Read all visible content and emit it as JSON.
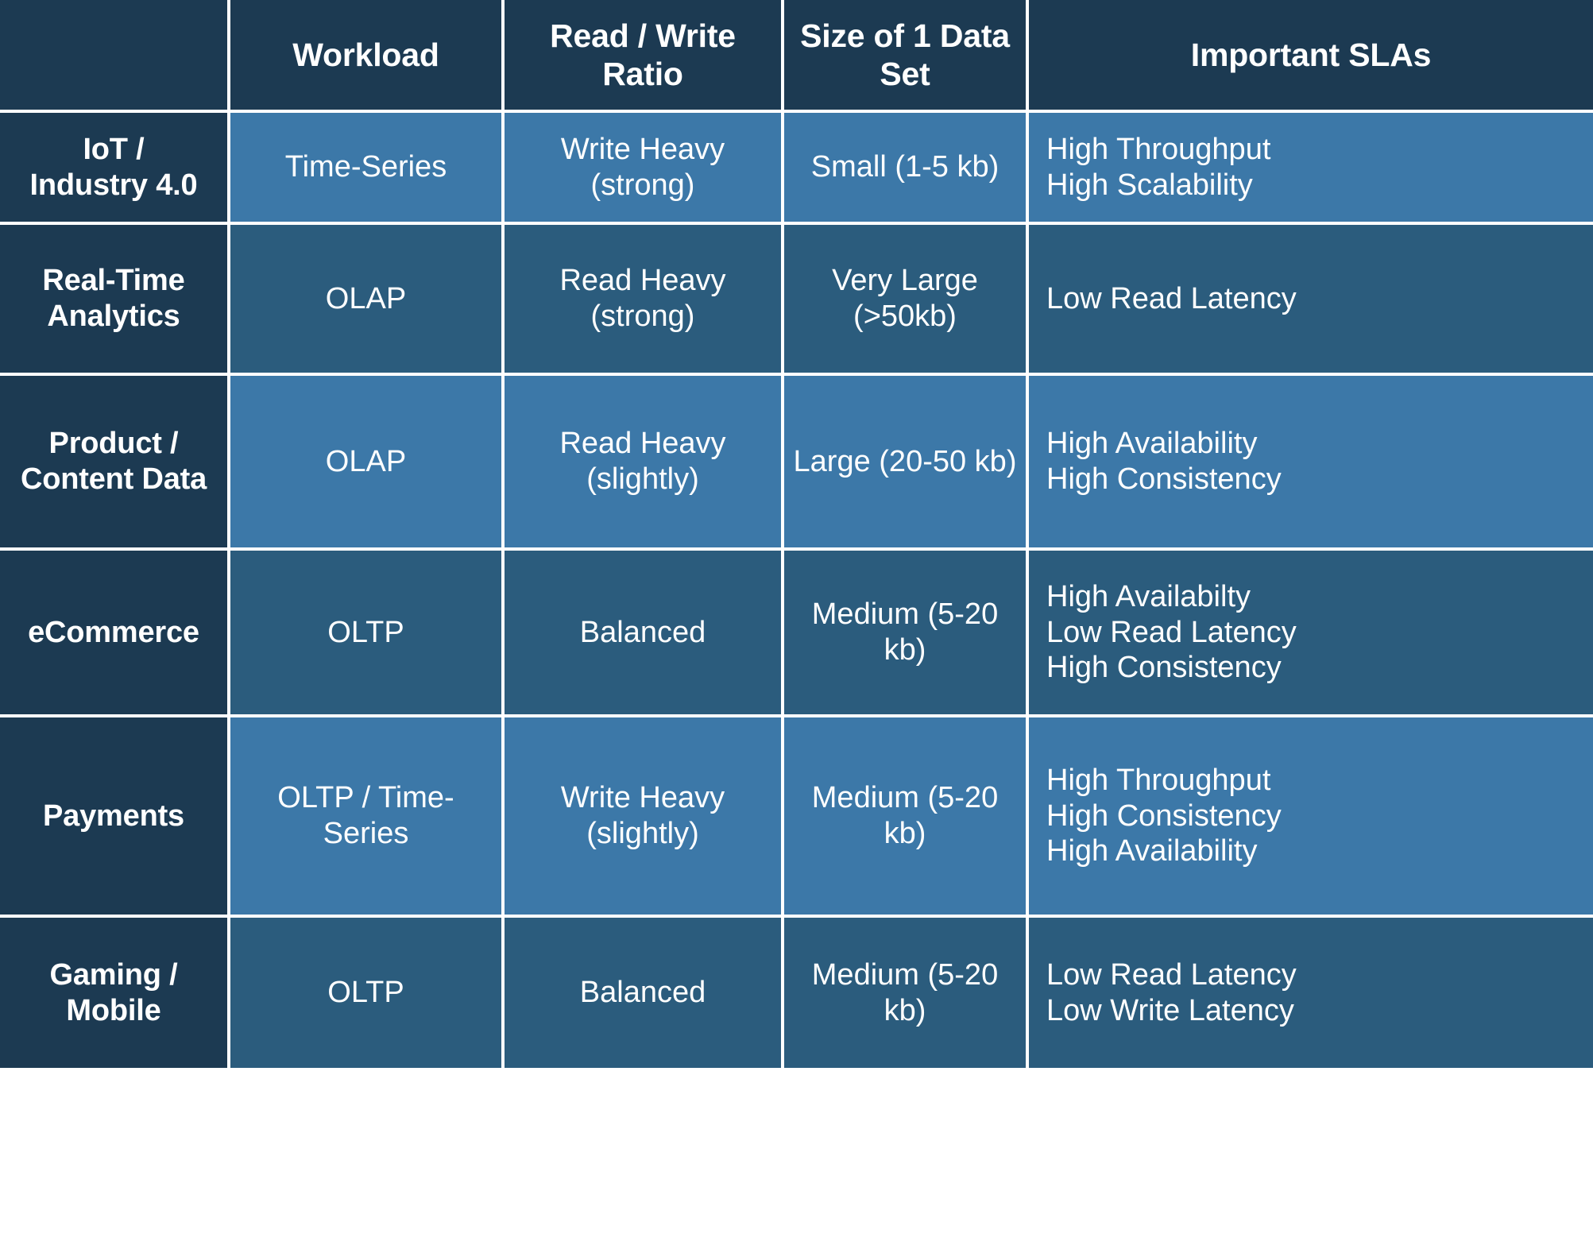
{
  "table": {
    "corner_label": "",
    "columns": [
      "Workload",
      "Read / Write Ratio",
      "Size of 1 Data Set",
      "Important SLAs"
    ],
    "rows": [
      {
        "label": "IoT /\nIndustry 4.0",
        "workload": "Time-Series",
        "read_write_ratio": "Write Heavy (strong)",
        "data_set_size": "Small (1-5 kb)",
        "slas": "High Throughput\nHigh Scalability"
      },
      {
        "label": "Real-Time\nAnalytics",
        "workload": "OLAP",
        "read_write_ratio": "Read Heavy (strong)",
        "data_set_size": "Very Large (>50kb)",
        "slas": "Low Read Latency"
      },
      {
        "label": "Product /\nContent Data",
        "workload": "OLAP",
        "read_write_ratio": "Read Heavy (slightly)",
        "data_set_size": "Large (20-50 kb)",
        "slas": "High Availability\nHigh Consistency"
      },
      {
        "label": "eCommerce",
        "workload": "OLTP",
        "read_write_ratio": "Balanced",
        "data_set_size": "Medium (5-20 kb)",
        "slas": "High Availabilty\nLow Read Latency\nHigh Consistency"
      },
      {
        "label": "Payments",
        "workload": "OLTP / Time-Series",
        "read_write_ratio": "Write Heavy (slightly)",
        "data_set_size": "Medium (5-20 kb)",
        "slas": "High Throughput\nHigh Consistency\nHigh Availability"
      },
      {
        "label": "Gaming /\nMobile",
        "workload": "OLTP",
        "read_write_ratio": "Balanced",
        "data_set_size": "Medium (5-20 kb)",
        "slas": "Low Read Latency\nLow Write Latency"
      }
    ]
  },
  "colors": {
    "header_background": "#1C3A52",
    "row_label_background": "#1C3A52",
    "cell_tint_light": "#3C78A8",
    "cell_tint_dark": "#2B5C7D",
    "gridline": "#FFFFFF",
    "text": "#FFFFFF"
  }
}
